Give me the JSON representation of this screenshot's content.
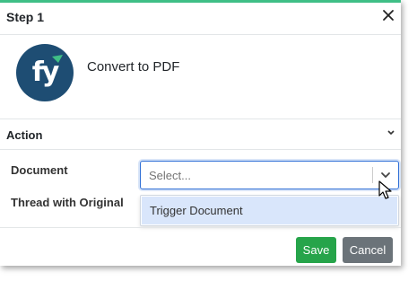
{
  "header": {
    "title": "Step 1",
    "close_icon": "close-icon"
  },
  "app": {
    "name": "Convert to PDF",
    "logo_text": "fy",
    "brand_color": "#1e4d73",
    "accent_color": "#3fbf86"
  },
  "section": {
    "title": "Action",
    "chevron_icon": "chevron-down-icon"
  },
  "fields": {
    "document_label": "Document",
    "thread_label": "Thread with Original",
    "document_select": {
      "placeholder": "Select...",
      "options": [
        "Trigger Document"
      ]
    }
  },
  "footer": {
    "save_label": "Save",
    "cancel_label": "Cancel",
    "save_color": "#26a44a",
    "cancel_color": "#6b7379"
  }
}
